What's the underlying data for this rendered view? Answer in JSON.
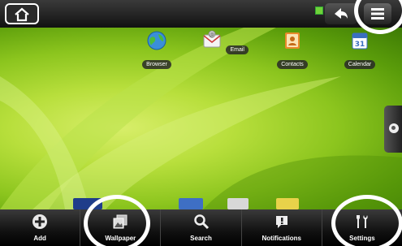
{
  "apps": [
    {
      "label": "Browser",
      "icon": "browser-globe-icon"
    },
    {
      "label": "Email",
      "icon": "email-icon"
    },
    {
      "label": "Contacts",
      "icon": "contacts-icon"
    },
    {
      "label": "Calendar",
      "icon": "calendar-icon",
      "badge": "31"
    }
  ],
  "actions": [
    {
      "label": "Add",
      "icon": "plus-circle-icon"
    },
    {
      "label": "Wallpaper",
      "icon": "wallpaper-icon"
    },
    {
      "label": "Search",
      "icon": "search-icon"
    },
    {
      "label": "Notifications",
      "icon": "notifications-icon"
    },
    {
      "label": "Settings",
      "icon": "settings-tools-icon"
    }
  ],
  "colors": {
    "wallpaper": "#8cc51e",
    "highlight": "#ffffff",
    "statusbar": "#1a1a1a",
    "signal": "#6fd23a"
  }
}
